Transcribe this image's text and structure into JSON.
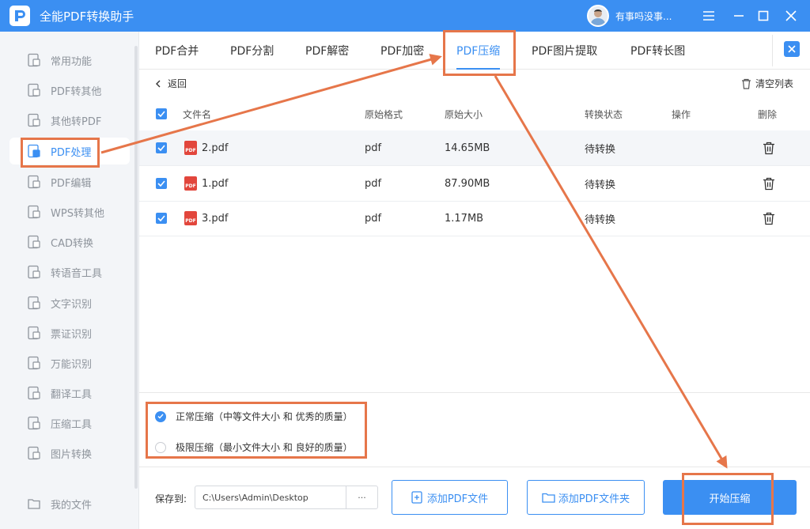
{
  "app": {
    "title": "全能PDF转换助手",
    "username": "有事吗没事..."
  },
  "window_controls": [
    "menu-icon",
    "minimize-icon",
    "maximize-icon",
    "close-icon"
  ],
  "sidebar": {
    "items": [
      {
        "label": "常用功能",
        "icon": "star-doc-icon"
      },
      {
        "label": "PDF转其他",
        "icon": "pdf-convert-icon"
      },
      {
        "label": "其他转PDF",
        "icon": "to-pdf-icon"
      },
      {
        "label": "PDF处理",
        "icon": "pdf-process-icon",
        "active": true
      },
      {
        "label": "PDF编辑",
        "icon": "pdf-edit-icon"
      },
      {
        "label": "WPS转其他",
        "icon": "wps-icon"
      },
      {
        "label": "CAD转换",
        "icon": "cad-icon"
      },
      {
        "label": "转语音工具",
        "icon": "speech-icon"
      },
      {
        "label": "文字识别",
        "icon": "ocr-icon"
      },
      {
        "label": "票证识别",
        "icon": "ticket-icon"
      },
      {
        "label": "万能识别",
        "icon": "scan-icon"
      },
      {
        "label": "翻译工具",
        "icon": "translate-icon"
      },
      {
        "label": "压缩工具",
        "icon": "compress-icon"
      },
      {
        "label": "图片转换",
        "icon": "image-icon"
      }
    ],
    "my_files": "我的文件"
  },
  "tabs": [
    {
      "label": "PDF合并"
    },
    {
      "label": "PDF分割"
    },
    {
      "label": "PDF解密"
    },
    {
      "label": "PDF加密"
    },
    {
      "label": "PDF压缩",
      "active": true
    },
    {
      "label": "PDF图片提取"
    },
    {
      "label": "PDF转长图"
    }
  ],
  "toolbar": {
    "back": "返回",
    "clear_list": "清空列表"
  },
  "table": {
    "columns": [
      "文件名",
      "原始格式",
      "原始大小",
      "转换状态",
      "操作",
      "删除"
    ],
    "rows": [
      {
        "name": "2.pdf",
        "format": "pdf",
        "size": "14.65MB",
        "status": "待转换"
      },
      {
        "name": "1.pdf",
        "format": "pdf",
        "size": "87.90MB",
        "status": "待转换"
      },
      {
        "name": "3.pdf",
        "format": "pdf",
        "size": "1.17MB",
        "status": "待转换"
      }
    ]
  },
  "options": {
    "normal": "正常压缩（中等文件大小 和 优秀的质量）",
    "extreme": "极限压缩（最小文件大小 和 良好的质量）",
    "selected": "normal"
  },
  "bottom": {
    "save_to_label": "保存到:",
    "save_path": "C:\\Users\\Admin\\Desktop",
    "path_more": "···",
    "add_file": "添加PDF文件",
    "add_folder": "添加PDF文件夹",
    "start": "开始压缩"
  },
  "colors": {
    "accent": "#3b8ff2",
    "annotation": "#e6764a",
    "pdf_red": "#e2463c"
  }
}
